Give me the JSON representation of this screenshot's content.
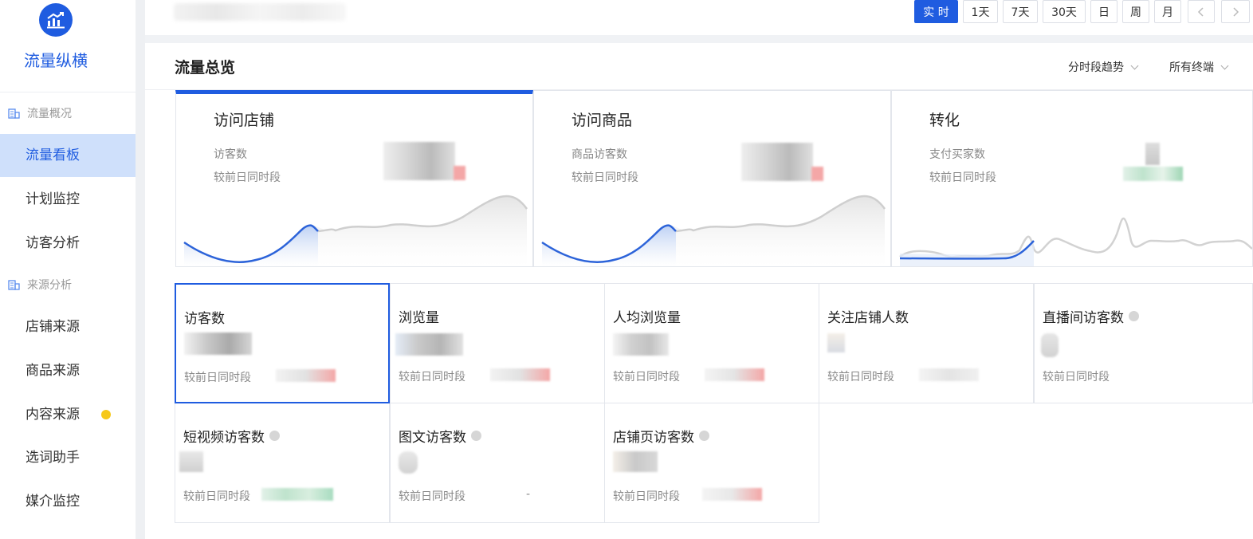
{
  "sidebar": {
    "brand": "流量纵横",
    "groups": [
      {
        "title": "流量概况",
        "items": [
          "流量看板",
          "计划监控",
          "访客分析"
        ]
      },
      {
        "title": "来源分析",
        "items": [
          "店铺来源",
          "商品来源",
          "内容来源",
          "选词助手",
          "媒介监控"
        ]
      }
    ],
    "active_item": "流量看板"
  },
  "toolbar": {
    "ranges": [
      "实 时",
      "1天",
      "7天",
      "30天",
      "日",
      "周",
      "月"
    ],
    "active_range": "实 时"
  },
  "panel": {
    "title": "流量总览",
    "dropdowns": [
      "分时段趋势",
      "所有终端"
    ]
  },
  "overview_cards": [
    {
      "title": "访问店铺",
      "metric": "访客数",
      "compare": "较前日同时段"
    },
    {
      "title": "访问商品",
      "metric": "商品访客数",
      "compare": "较前日同时段"
    },
    {
      "title": "转化",
      "metric": "支付买家数",
      "compare": "较前日同时段"
    }
  ],
  "metrics": [
    {
      "title": "访客数",
      "compare": "较前日同时段"
    },
    {
      "title": "浏览量",
      "compare": "较前日同时段"
    },
    {
      "title": "人均浏览量",
      "compare": "较前日同时段"
    },
    {
      "title": "关注店铺人数",
      "compare": "较前日同时段"
    },
    {
      "title": "直播间访客数",
      "compare": "较前日同时段"
    },
    {
      "title": "短视频访客数",
      "compare": "较前日同时段"
    },
    {
      "title": "图文访客数",
      "compare": "较前日同时段",
      "delta": "-"
    },
    {
      "title": "店铺页访客数",
      "compare": "较前日同时段"
    }
  ],
  "colors": {
    "accent": "#1f5ce0",
    "dot": "#f6c819",
    "up": "#f4a7a7",
    "down": "#a8dcc0"
  },
  "icons": {
    "logo": "trend-chart-icon",
    "group": "building-icon",
    "info": "info-dot-icon"
  }
}
